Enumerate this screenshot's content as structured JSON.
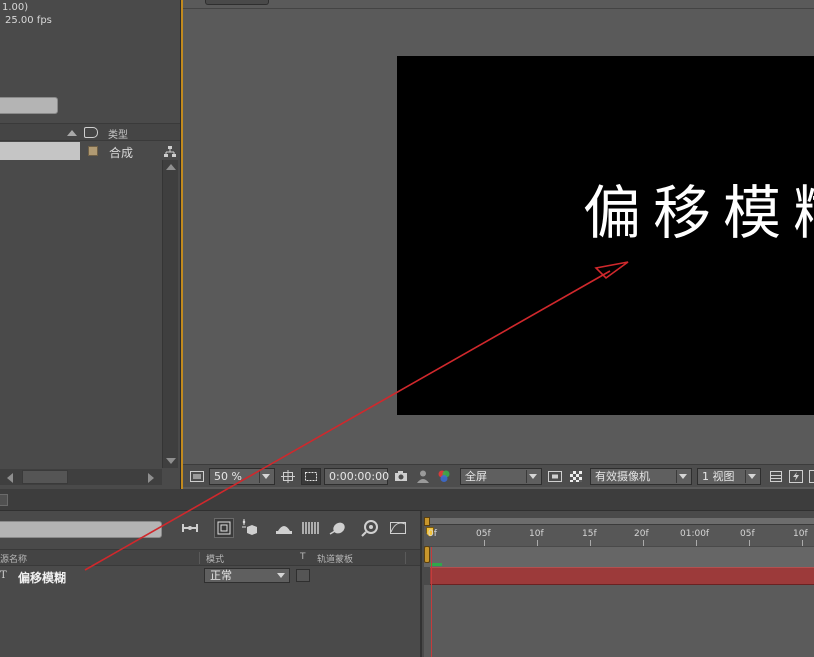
{
  "project": {
    "info_line1": "1.00)",
    "info_line2": "25.00 fps",
    "column_type": "类型",
    "item": {
      "type": "合成",
      "label_color": "#b09a73"
    }
  },
  "viewer": {
    "canvas_text": "偏移模糊",
    "toolbar": {
      "zoom": "50 %",
      "timecode": "0:00:00:00",
      "resolution": "全屏",
      "camera": "有效摄像机",
      "views": "1 视图"
    },
    "accent_color": "#c28a1e"
  },
  "timeline": {
    "columns": {
      "source_name": "源名称",
      "mode": "模式",
      "t": "T",
      "trkmat": "轨道蒙板"
    },
    "layer": {
      "type_glyph": "T",
      "name": "偏移模糊",
      "mode": "正常",
      "bar_color": "#9c3a3a"
    },
    "ruler_ticks": [
      "0f",
      "05f",
      "10f",
      "15f",
      "20f",
      "01:00f",
      "05f",
      "10f"
    ]
  },
  "annotation": {
    "color": "#d0282c"
  }
}
